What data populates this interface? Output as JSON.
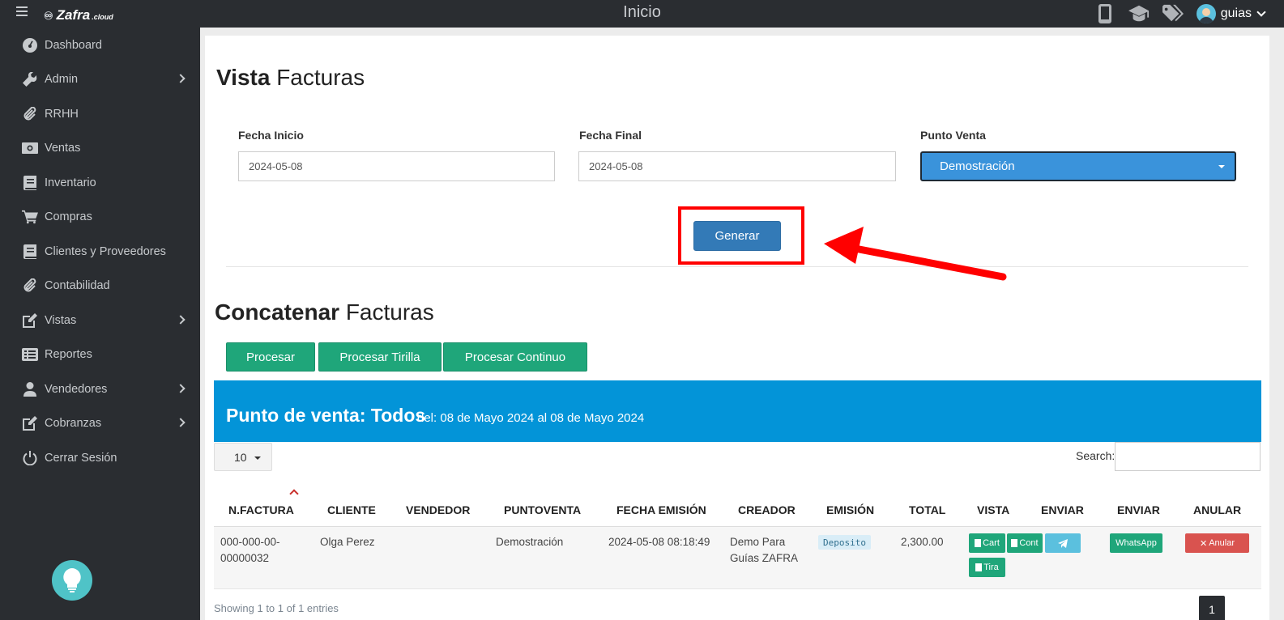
{
  "topbar": {
    "logo_text": "Zafra",
    "logo_suffix": ".cloud",
    "title": "Inicio",
    "user": "guias"
  },
  "sidebar": {
    "items": [
      {
        "label": "Dashboard",
        "icon": "dashboard-icon",
        "has_submenu": false
      },
      {
        "label": "Admin",
        "icon": "wrench-icon",
        "has_submenu": true
      },
      {
        "label": "RRHH",
        "icon": "paperclip-icon",
        "has_submenu": false
      },
      {
        "label": "Ventas",
        "icon": "money-icon",
        "has_submenu": false
      },
      {
        "label": "Inventario",
        "icon": "book-icon",
        "has_submenu": false
      },
      {
        "label": "Compras",
        "icon": "cart-icon",
        "has_submenu": false
      },
      {
        "label": "Clientes y Proveedores",
        "icon": "book-icon",
        "has_submenu": false
      },
      {
        "label": "Contabilidad",
        "icon": "paperclip-icon",
        "has_submenu": false
      },
      {
        "label": "Vistas",
        "icon": "edit-icon",
        "has_submenu": true
      },
      {
        "label": "Reportes",
        "icon": "list-icon",
        "has_submenu": false
      },
      {
        "label": "Vendedores",
        "icon": "user-icon",
        "has_submenu": true
      },
      {
        "label": "Cobranzas",
        "icon": "edit-icon",
        "has_submenu": true
      },
      {
        "label": "Cerrar Sesión",
        "icon": "power-icon",
        "has_submenu": false
      }
    ]
  },
  "vista": {
    "title_bold": "Vista",
    "title_rest": "Facturas",
    "fecha_inicio_label": "Fecha Inicio",
    "fecha_inicio_value": "2024-05-08",
    "fecha_final_label": "Fecha Final",
    "fecha_final_value": "2024-05-08",
    "punto_venta_label": "Punto Venta",
    "punto_venta_value": "Demostración",
    "generar_label": "Generar"
  },
  "concatenar": {
    "title_bold": "Concatenar",
    "title_rest": "Facturas",
    "buttons": [
      "Procesar",
      "Procesar Tirilla",
      "Procesar Continuo"
    ]
  },
  "banner": {
    "title": "Punto de venta: Todos",
    "subtitle": "del: 08 de Mayo 2024 al 08 de Mayo 2024"
  },
  "table": {
    "page_length": "10",
    "search_label": "Search:",
    "columns": [
      "N.FACTURA",
      "CLIENTE",
      "VENDEDOR",
      "PUNTOVENTA",
      "FECHA EMISIÓN",
      "CREADOR",
      "EMISIÓN",
      "TOTAL",
      "VISTA",
      "ENVIAR",
      "ENVIAR",
      "ANULAR"
    ],
    "rows": [
      {
        "factura_line1": "000-000-00-",
        "factura_line2": "00000032",
        "cliente": "Olga Perez",
        "vendedor": "",
        "puntoventa": "Demostración",
        "fecha": "2024-05-08 08:18:49",
        "creador_line1": "Demo Para",
        "creador_line2": "Guías ZAFRA",
        "emision": "Deposito",
        "total": "2,300.00",
        "vista_buttons": [
          "Cart",
          "Cont",
          "Tira"
        ],
        "whatsapp": "WhatsApp",
        "anular": "Anular"
      }
    ],
    "info": "Showing 1 to 1 of 1 entries",
    "current_page": "1"
  },
  "colors": {
    "sidebar_bg": "#2a2d31",
    "primary": "#337ab7",
    "success": "#1fa67a",
    "banner": "#0394d8",
    "danger": "#d9534f",
    "annotation": "#ff0000"
  }
}
